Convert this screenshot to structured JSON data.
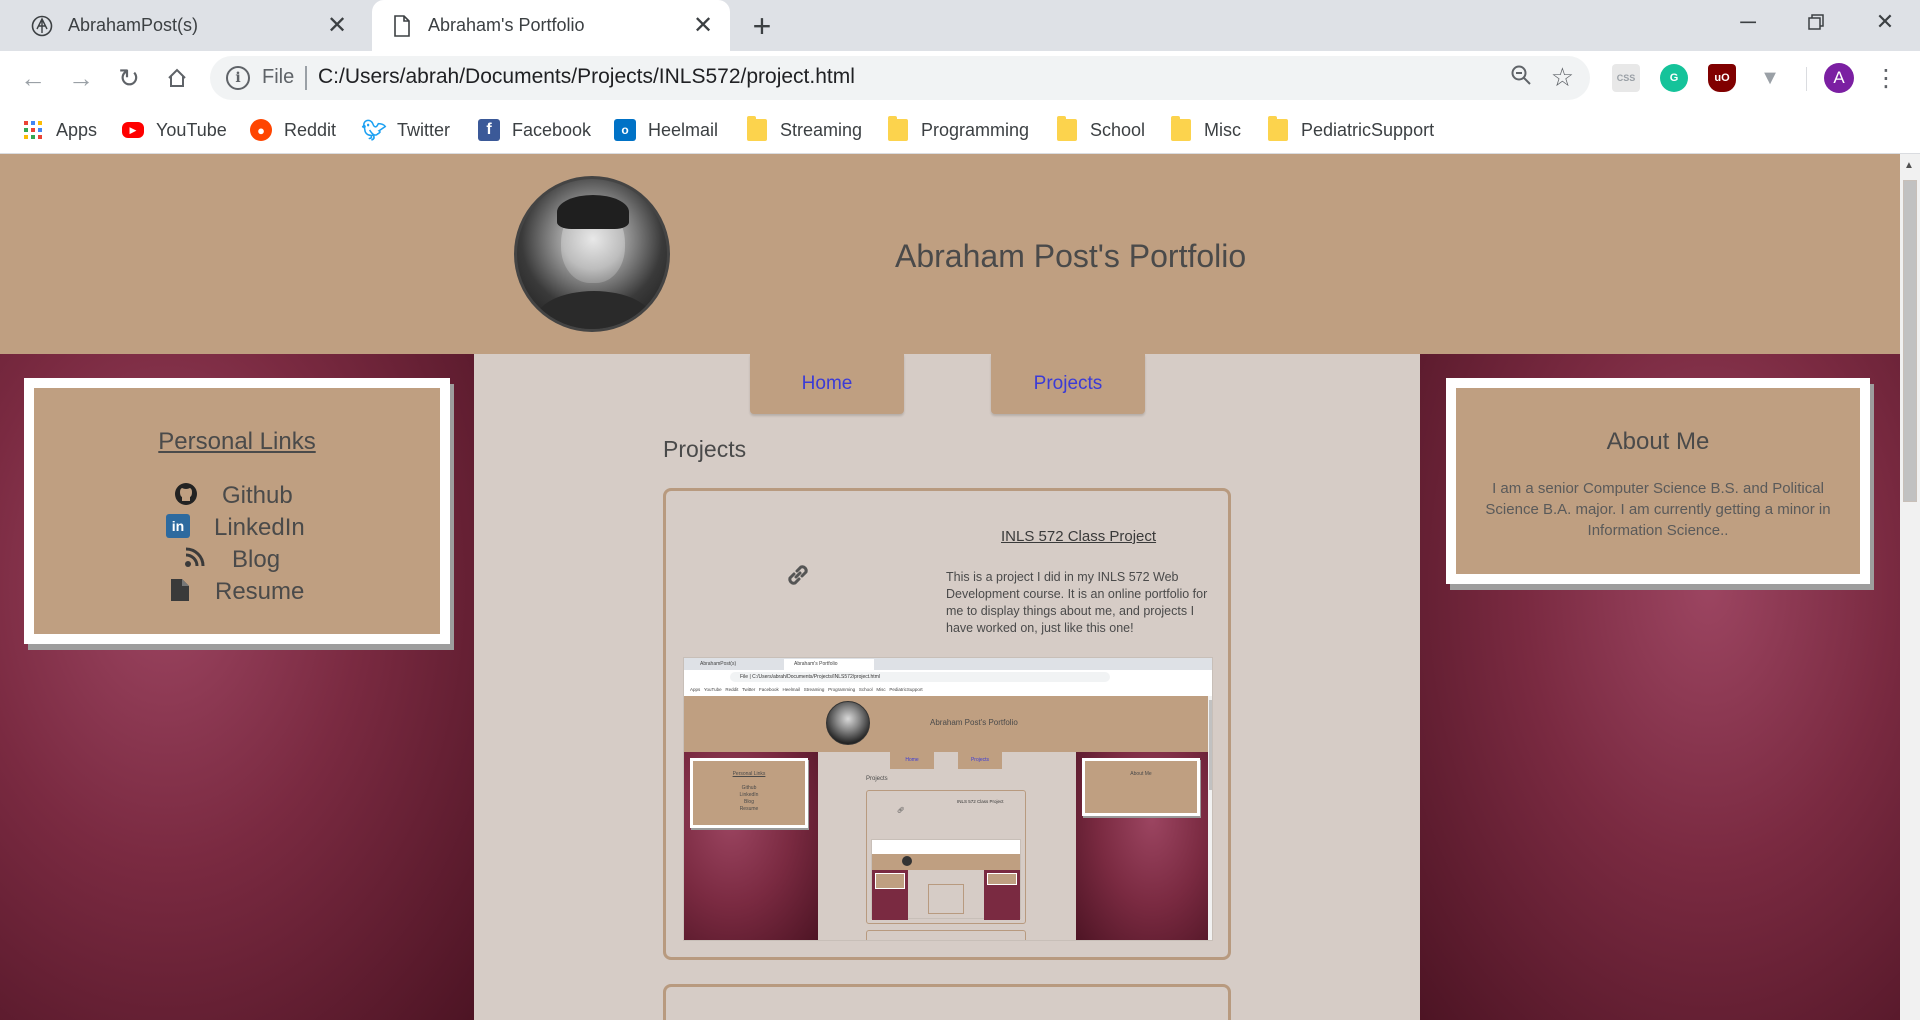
{
  "browser": {
    "tabs": [
      {
        "title": "AbrahamPost(s)",
        "active": false
      },
      {
        "title": "Abraham's Portfolio",
        "active": true
      }
    ],
    "address": {
      "scheme": "File",
      "url": "C:/Users/abrah/Documents/Projects/INLS572/project.html"
    },
    "extensions": [
      "css-viewer-icon",
      "grammarly-icon",
      "ublock-icon",
      "vue-devtools-icon"
    ],
    "profile_initial": "A",
    "bookmarks": [
      {
        "label": "Apps",
        "icon": "apps-grid-icon"
      },
      {
        "label": "YouTube",
        "icon": "youtube-icon"
      },
      {
        "label": "Reddit",
        "icon": "reddit-icon"
      },
      {
        "label": "Twitter",
        "icon": "twitter-icon"
      },
      {
        "label": "Facebook",
        "icon": "facebook-icon"
      },
      {
        "label": "Heelmail",
        "icon": "outlook-icon"
      },
      {
        "label": "Streaming",
        "icon": "folder-icon"
      },
      {
        "label": "Programming",
        "icon": "folder-icon"
      },
      {
        "label": "School",
        "icon": "folder-icon"
      },
      {
        "label": "Misc",
        "icon": "folder-icon"
      },
      {
        "label": "PediatricSupport",
        "icon": "folder-icon"
      }
    ]
  },
  "site": {
    "title": "Abraham Post's Portfolio",
    "nav": [
      "Home",
      "Projects"
    ],
    "links_card": {
      "heading": "Personal Links",
      "links": [
        {
          "label": "Github",
          "icon": "github-icon"
        },
        {
          "label": "LinkedIn",
          "icon": "linkedin-icon"
        },
        {
          "label": "Blog",
          "icon": "blog-icon"
        },
        {
          "label": "Resume",
          "icon": "document-icon"
        }
      ]
    },
    "about_card": {
      "heading": "About Me",
      "text": "I am a senior Computer Science B.S. and Political Science B.A. major. I am currently getting a minor in Information Science.."
    },
    "projects_heading": "Projects",
    "project": {
      "title": "INLS 572 Class Project",
      "description": "This is a project I did in my INLS 572 Web Development course. It is an online portfolio for me to display things about me, and projects I have worked on, just like this one!"
    }
  },
  "colors": {
    "header_bg": "#bf9f81",
    "content_bg": "#d6ccc6",
    "sidebar_maroon": "#7a2a41",
    "nav_link": "#3b3bd6"
  }
}
